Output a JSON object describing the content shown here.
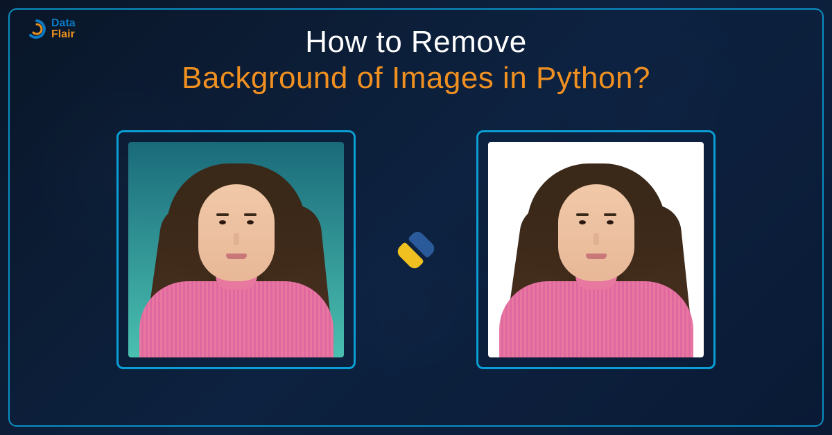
{
  "logo": {
    "line1": "Data",
    "line2": "Flair"
  },
  "title": {
    "line1": "How to Remove",
    "line2": "Background of Images in Python?"
  },
  "images": {
    "before_label": "original-image-with-background",
    "after_label": "image-background-removed"
  },
  "colors": {
    "accent_blue": "#0a9fd4",
    "accent_orange": "#f09020",
    "bg_dark": "#0a1a35"
  }
}
